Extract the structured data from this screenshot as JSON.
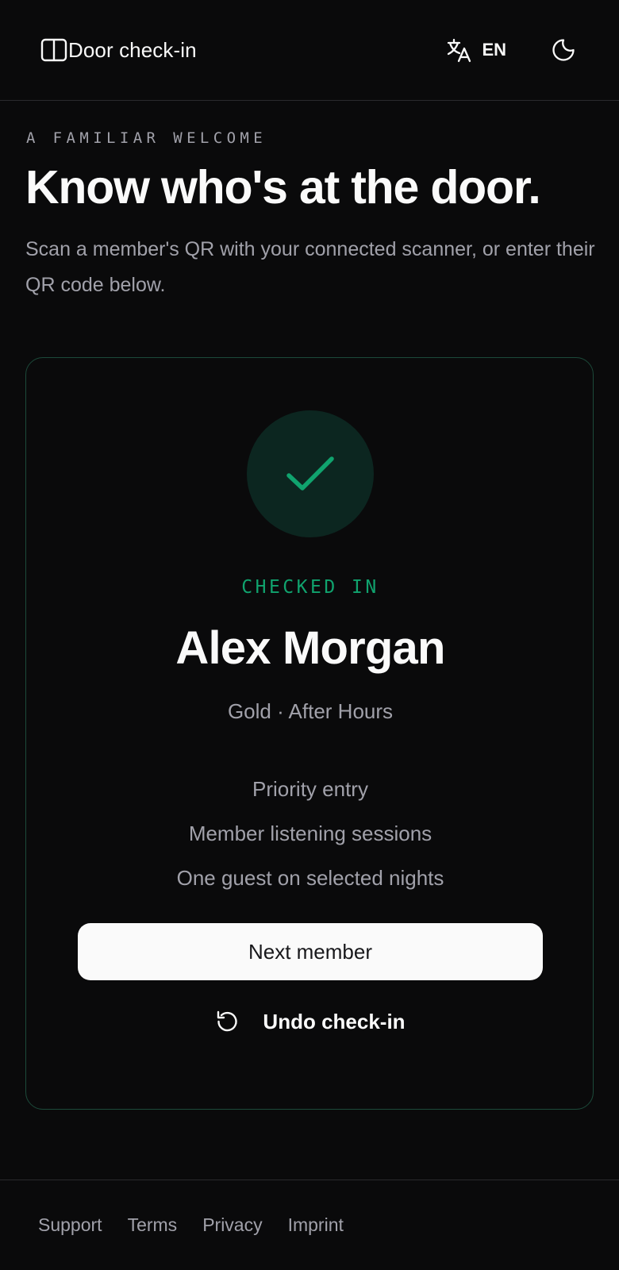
{
  "header": {
    "title": "Door check-in",
    "language": "EN",
    "icons": {
      "sidebar": "sidebar-toggle-icon",
      "translate": "translate-icon",
      "theme": "moon-icon"
    }
  },
  "hero": {
    "eyebrow": "A FAMILIAR WELCOME",
    "headline": "Know who's at the door.",
    "subtext": "Scan a member's QR with your connected scanner, or enter their QR code below."
  },
  "result": {
    "status": "CHECKED IN",
    "status_icon": "check-icon",
    "name": "Alex Morgan",
    "tier": "Gold · After Hours",
    "perks": [
      "Priority entry",
      "Member listening sessions",
      "One guest on selected nights"
    ],
    "next_button": "Next member",
    "undo_button": "Undo check-in",
    "undo_icon": "undo-icon"
  },
  "footer": {
    "links": [
      "Support",
      "Terms",
      "Privacy",
      "Imprint"
    ]
  },
  "colors": {
    "background": "#0a0a0b",
    "foreground": "#fafafa",
    "muted": "#a1a1aa",
    "success": "#10a36e",
    "success_bg": "#0c2620",
    "card_border": "#1c4a3a",
    "divider": "#2a2a2d"
  }
}
